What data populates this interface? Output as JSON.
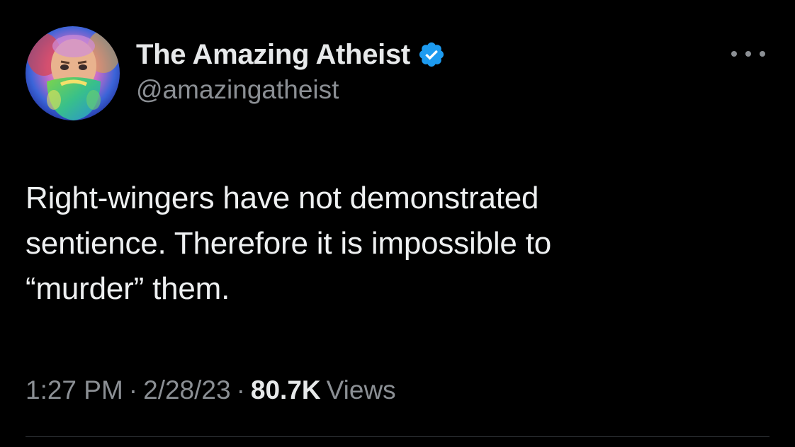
{
  "tweet": {
    "author": {
      "display_name": "The Amazing Atheist",
      "handle": "@amazingatheist",
      "verified": true
    },
    "text": "Right-wingers have not demonstrated\nsentience. Therefore it is impossible to\n“murder” them.",
    "meta": {
      "time": "1:27 PM",
      "separator": "·",
      "date": "2/28/23",
      "views_count": "80.7K",
      "views_label": "Views"
    }
  },
  "icons": {
    "verified": "verified-badge-icon",
    "more": "more-options-icon"
  },
  "colors": {
    "background": "#000000",
    "primary_text": "#e7e9ea",
    "secondary_text": "#8b8f94",
    "verified_blue": "#1d9bf0",
    "divider": "#2f3336"
  }
}
